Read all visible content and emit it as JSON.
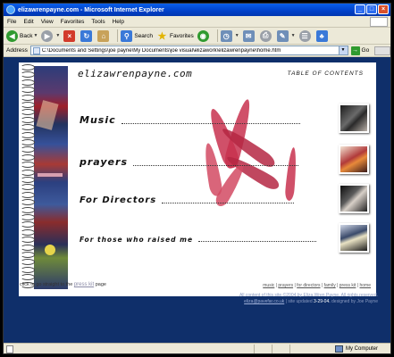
{
  "window": {
    "title": "elizawrenpayne.com - Microsoft Internet Explorer",
    "controls": [
      "_",
      "□",
      "×"
    ]
  },
  "menu": [
    "File",
    "Edit",
    "View",
    "Favorites",
    "Tools",
    "Help"
  ],
  "toolbar": {
    "back_label": "Back",
    "search_label": "Search",
    "favorites_label": "Favorites"
  },
  "address": {
    "label": "Address",
    "url": "C:\\Documents and Settings\\joe payne\\My Documents\\joe visual\\elizawork\\elizawrenpayne\\home.htm",
    "go_label": "Go"
  },
  "site": {
    "title": "elizawrenpayne.com",
    "toc": "TABLE OF CONTENTS",
    "nav": [
      {
        "label": "Music"
      },
      {
        "label": "prayers"
      },
      {
        "label": "For Directors"
      },
      {
        "label": "For those who raised me"
      }
    ],
    "press_prefix": "click to go straight to the",
    "press_link": "press kit",
    "press_suffix": "page",
    "footer_nav": [
      "music",
      "prayers",
      "for directors",
      "family",
      "press kit",
      "home"
    ],
    "footer_line1": "All content of this site ©2004 by Eliza Wren Payne. All rights reserved.",
    "footer_email": "eliza@pavefar.co.uk",
    "footer_updated": "| site updated",
    "footer_date": "3-29-04.",
    "footer_designed": "designed by Joe Payne"
  },
  "status": {
    "zone": "My Computer"
  },
  "colors": {
    "background": "#0f2f6a",
    "accent_leaf": "#c8314f"
  }
}
